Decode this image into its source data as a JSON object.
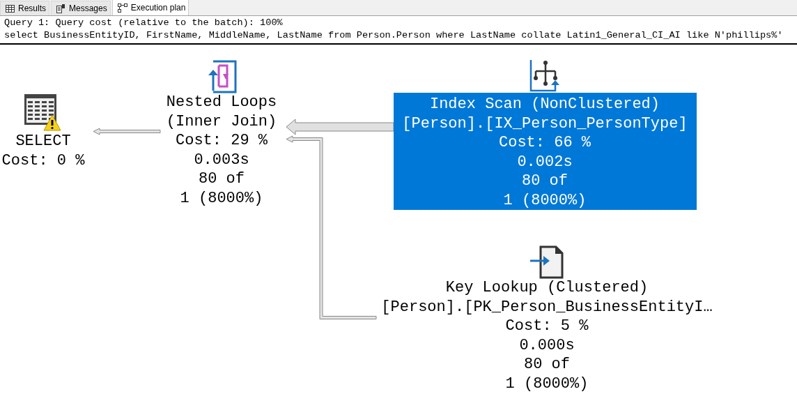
{
  "tabs": [
    {
      "label": "Results",
      "kind": "grid",
      "selected": false
    },
    {
      "label": "Messages",
      "kind": "messages",
      "selected": false
    },
    {
      "label": "Execution plan",
      "kind": "plan",
      "selected": true
    }
  ],
  "header": {
    "summary": "Query 1: Query cost (relative to the batch): 100%",
    "statement": "select BusinessEntityID, FirstName, MiddleName, LastName from Person.Person where LastName collate Latin1_General_CI_AI like N'phillips%'"
  },
  "nodes": [
    {
      "kind": "select",
      "name": "SELECT",
      "cost": "Cost: 0 %",
      "warning": true,
      "selected": false
    },
    {
      "kind": "nested-loops",
      "name": "Nested Loops",
      "detail": "(Inner Join)",
      "cost": "Cost: 29 %",
      "time": "0.003s",
      "rows": "80 of",
      "estimate": "1 (8000%)",
      "warning": false,
      "selected": false
    },
    {
      "kind": "index-scan",
      "name": "Index Scan (NonClustered)",
      "object": "[Person].[IX_Person_PersonType]",
      "cost": "Cost: 66 %",
      "time": "0.002s",
      "rows": "80 of",
      "estimate": "1 (8000%)",
      "warning": false,
      "selected": true
    },
    {
      "kind": "key-lookup",
      "name": "Key Lookup (Clustered)",
      "object": "[Person].[PK_Person_BusinessEntityI…",
      "cost": "Cost: 5 %",
      "time": "0.000s",
      "rows": "80 of",
      "estimate": "1 (8000%)",
      "warning": false,
      "selected": false
    }
  ]
}
